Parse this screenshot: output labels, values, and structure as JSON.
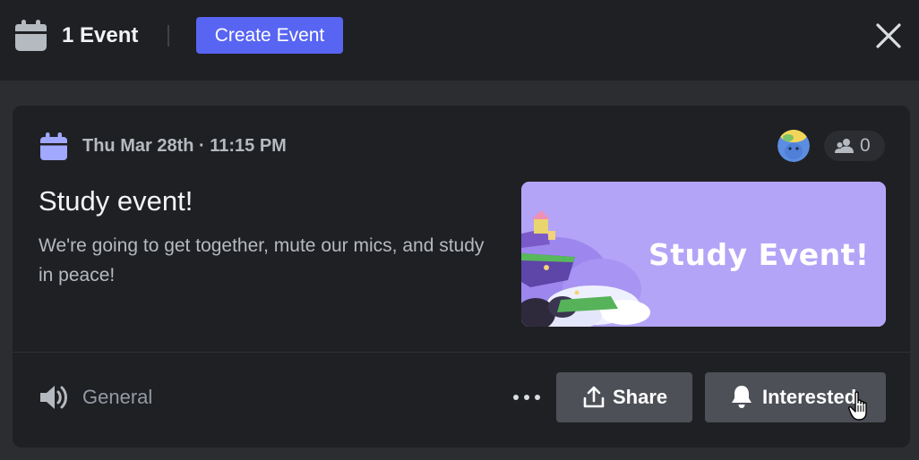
{
  "header": {
    "event_count": "1 Event",
    "create_button": "Create Event",
    "icons": {
      "calendar": "calendar-icon",
      "close": "close-icon"
    }
  },
  "event": {
    "date_time": "Thu Mar 28th · 11:15 PM",
    "interested_count": "0",
    "title": "Study event!",
    "description": "We're going to get together, mute our mics, and study in peace!",
    "cover_text": "Study Event!",
    "channel": "General",
    "share_label": "Share",
    "interested_label": "Interested"
  },
  "colors": {
    "accent": "#5865f2",
    "calendar_icon_card": "#a0a8ff",
    "cover_bg": "#b4a4f7",
    "button_bg": "#4e5058"
  }
}
